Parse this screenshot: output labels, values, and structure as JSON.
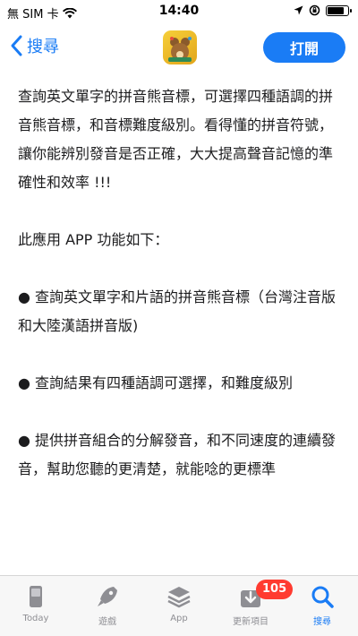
{
  "status_bar": {
    "carrier": "無 SIM 卡",
    "wifi_icon": "wifi-icon",
    "time": "14:40",
    "battery_level": 0.85
  },
  "nav": {
    "back_label": "搜尋",
    "open_label": "打開"
  },
  "description": {
    "paragraphs": [
      "查詢英文單字的拼音熊音標，可選擇四種語調的拼音熊音標，和音標難度級別。看得懂的拼音符號，讓你能辨別發音是否正確，大大提高聲音記憶的準確性和效率 !!!",
      "此應用 APP 功能如下：",
      "● 查詢英文單字和片語的拼音熊音標（台灣注音版和大陸漢語拼音版)",
      "● 查詢結果有四種語調可選擇，和難度級別",
      "● 提供拼音組合的分解發音，和不同速度的連續發音，幫助您聽的更清楚，就能唸的更標準"
    ]
  },
  "tab_bar": {
    "tabs": [
      {
        "label": "Today",
        "icon": "today-icon"
      },
      {
        "label": "遊戲",
        "icon": "rocket-icon"
      },
      {
        "label": "App",
        "icon": "layers-icon"
      },
      {
        "label": "更新項目",
        "icon": "download-icon",
        "badge": "105"
      },
      {
        "label": "搜尋",
        "icon": "search-icon",
        "active": true
      }
    ]
  },
  "colors": {
    "accent": "#1a7cf5",
    "badge": "#ff3b30"
  }
}
